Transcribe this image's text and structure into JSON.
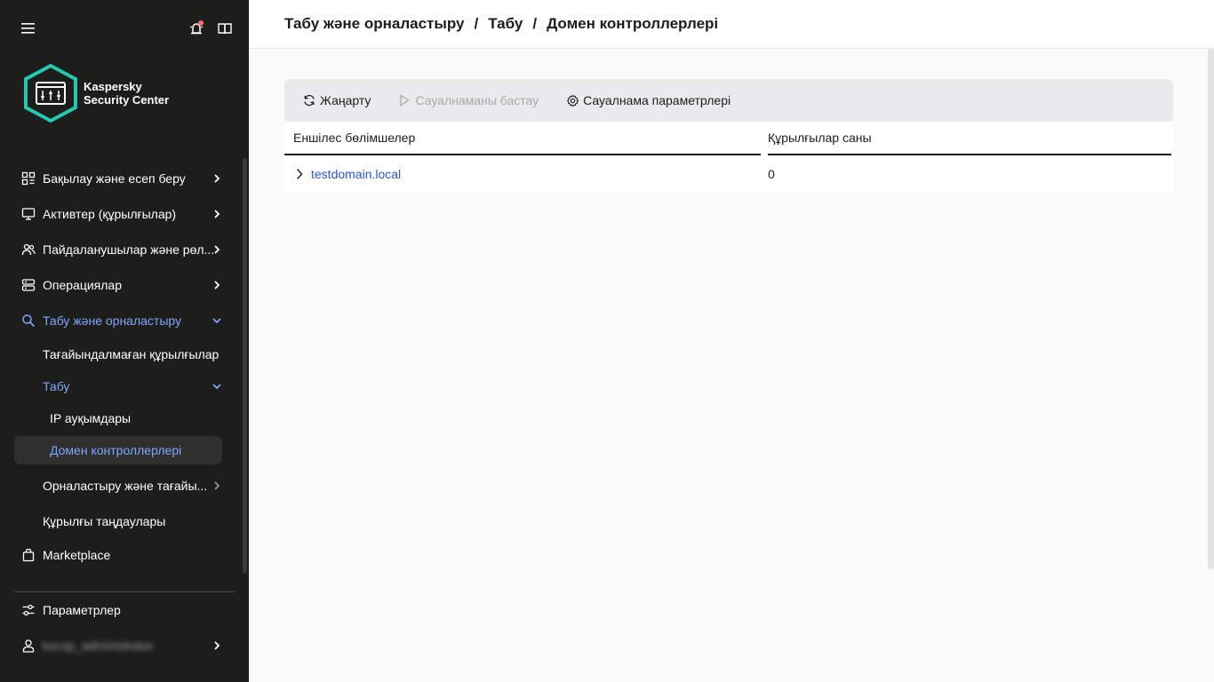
{
  "app": {
    "logo_line1": "Kaspersky",
    "logo_line2": "Security Center",
    "accent_color": "#7fa7ff",
    "brand_color": "#26c6b0",
    "notification_dot_color": "#ff6b6b"
  },
  "sidebar": {
    "items": [
      {
        "label": "Бақылау және есеп беру",
        "icon": "dashboard-icon"
      },
      {
        "label": "Активтер (құрылғылар)",
        "icon": "monitor-icon"
      },
      {
        "label": "Пайдаланушылар және рөл...",
        "icon": "users-icon"
      },
      {
        "label": "Операциялар",
        "icon": "server-icon"
      },
      {
        "label": "Табу және орналастыру",
        "icon": "search-icon"
      }
    ],
    "sub_items": {
      "unassigned": "Тағайындалмаған құрылғылар",
      "discovery": "Табу",
      "ip_ranges": "IP ауқымдары",
      "domain_controllers": "Домен контроллерлері",
      "deploy": "Орналастыру және тағайы...",
      "device_selections": "Құрылғы таңдаулары"
    },
    "marketplace": "Marketplace",
    "settings": "Параметрлер",
    "user": "kscsp_administrator"
  },
  "header": {
    "crumb1": "Табу және орналастыру",
    "crumb2": "Табу",
    "crumb3": "Домен контроллерлері",
    "separator": "/"
  },
  "toolbar": {
    "refresh": "Жаңарту",
    "start_poll": "Сауалнаманы бастау",
    "poll_settings": "Сауалнама параметрлері"
  },
  "table": {
    "columns": [
      "Еншілес бөлімшелер",
      "Құрылғылар саны"
    ],
    "rows": [
      {
        "name": "testdomain.local",
        "count": "0"
      }
    ]
  }
}
